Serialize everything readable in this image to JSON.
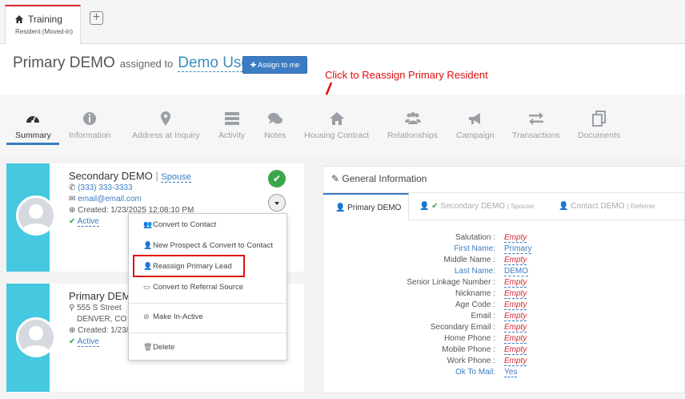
{
  "tab": {
    "title": "Training",
    "subtitle": "Resident (Moved-in)"
  },
  "header": {
    "name": "Primary DEMO",
    "assigned_text": "assigned to",
    "user": "Demo User",
    "assign_button": "Assign to me"
  },
  "annotation": "Click to Reassign Primary Resident",
  "nav": [
    {
      "label": "Summary",
      "icon": "dashboard-icon"
    },
    {
      "label": "Information",
      "icon": "info-icon"
    },
    {
      "label": "Address at Inquiry",
      "icon": "map-marker-icon"
    },
    {
      "label": "Activity",
      "icon": "list-icon"
    },
    {
      "label": "Notes",
      "icon": "comments-icon"
    },
    {
      "label": "Housing Contract",
      "icon": "home-icon"
    },
    {
      "label": "Relationships",
      "icon": "users-icon"
    },
    {
      "label": "Campaign",
      "icon": "megaphone-icon"
    },
    {
      "label": "Transactions",
      "icon": "exchange-icon"
    },
    {
      "label": "Documents",
      "icon": "documents-icon"
    }
  ],
  "card1": {
    "name": "Secondary DEMO",
    "relation": "Spouse",
    "phone": "(333) 333-3333",
    "email": "email@email.com",
    "created": "Created: 1/23/2025 12:08:10 PM",
    "status": "Active"
  },
  "card2": {
    "name": "Primary DEM",
    "address1": "555 S Street",
    "address2": "DENVER, CO 8",
    "created": "Created: 1/23/",
    "status": "Active"
  },
  "menu": {
    "items": [
      "Convert to Contact",
      "New Prospect & Convert to Contact",
      "Reassign Primary Lead",
      "Convert to Referral Source",
      "Make In-Active",
      "Delete"
    ]
  },
  "general": {
    "title": "General Information",
    "tabs": [
      {
        "name": "Primary DEMO",
        "role": ""
      },
      {
        "name": "Secondary DEMO",
        "role": "Spouse"
      },
      {
        "name": "Contact DEMO",
        "role": "Referrer"
      }
    ],
    "fields": [
      {
        "label": "Salutation :",
        "value": "Empty"
      },
      {
        "label": "First Name:",
        "value": "Primary"
      },
      {
        "label": "Middle Name :",
        "value": "Empty"
      },
      {
        "label": "Last Name:",
        "value": "DEMO"
      },
      {
        "label": "Senior Linkage Number :",
        "value": "Empty"
      },
      {
        "label": "Nickname :",
        "value": "Empty"
      },
      {
        "label": "Age Code :",
        "value": "Empty"
      },
      {
        "label": "Email :",
        "value": "Empty"
      },
      {
        "label": "Secondary Email :",
        "value": "Empty"
      },
      {
        "label": "Home Phone :",
        "value": "Empty"
      },
      {
        "label": "Mobile Phone :",
        "value": "Empty"
      },
      {
        "label": "Work Phone :",
        "value": "Empty"
      },
      {
        "label": "Ok To Mail:",
        "value": "Yes"
      }
    ]
  }
}
